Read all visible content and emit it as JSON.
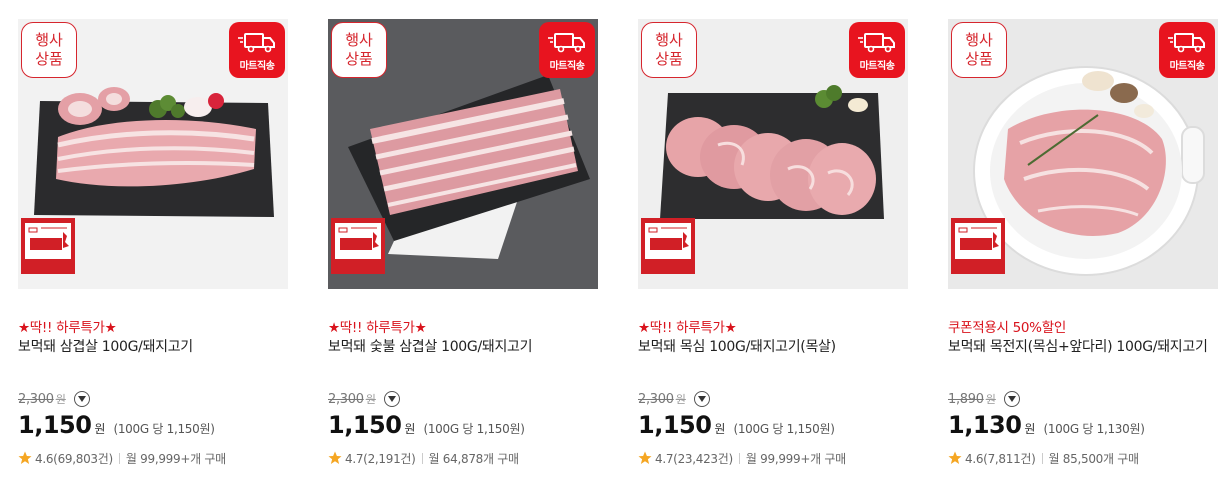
{
  "products": [
    {
      "event_badge": "행사\n상품",
      "delivery_label": "마트직송",
      "promo": "★딱!! 하루특가★",
      "name": "보먹돼 삼겹살 100G/돼지고기",
      "original_price": "2,300",
      "original_unit": "원",
      "price": "1,150",
      "price_unit": "원",
      "unit_price": "(100G 당 1,150원)",
      "rating": "4.6(69,803건)",
      "purchases": "월 99,999+개 구매"
    },
    {
      "event_badge": "행사\n상품",
      "delivery_label": "마트직송",
      "promo": "★딱!! 하루특가★",
      "name": "보먹돼 숯불 삼겹살 100G/돼지고기",
      "original_price": "2,300",
      "original_unit": "원",
      "price": "1,150",
      "price_unit": "원",
      "unit_price": "(100G 당 1,150원)",
      "rating": "4.7(2,191건)",
      "purchases": "월 64,878개 구매"
    },
    {
      "event_badge": "행사\n상품",
      "delivery_label": "마트직송",
      "promo": "★딱!! 하루특가★",
      "name": "보먹돼 목심 100G/돼지고기(목살)",
      "original_price": "2,300",
      "original_unit": "원",
      "price": "1,150",
      "price_unit": "원",
      "unit_price": "(100G 당 1,150원)",
      "rating": "4.7(23,423건)",
      "purchases": "월 99,999+개 구매"
    },
    {
      "event_badge": "행사\n상품",
      "delivery_label": "마트직송",
      "promo": "쿠폰적용시 50%할인",
      "name": "보먹돼 목전지(목심+앞다리) 100G/돼지고기",
      "original_price": "1,890",
      "original_unit": "원",
      "price": "1,130",
      "price_unit": "원",
      "unit_price": "(100G 당 1,130원)",
      "rating": "4.6(7,811건)",
      "purchases": "월 85,500개 구매"
    }
  ],
  "colors": {
    "accent_red": "#e8141f",
    "promo_red": "#d9141d",
    "star": "#f5a623"
  },
  "icons": {
    "delivery": "truck-icon",
    "info": "chevron-down-circle-icon",
    "rating": "star-icon"
  }
}
